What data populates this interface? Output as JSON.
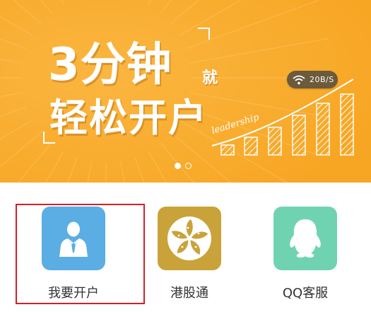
{
  "banner": {
    "slogan_line1": "3分钟",
    "slogan_jiu": "就",
    "slogan_line2": "轻松开户",
    "leadership": "leadership",
    "wifi_speed": "20B/S",
    "background_color": "#f9ab2e",
    "pager": {
      "total": 2,
      "active_index": 0
    }
  },
  "menu": {
    "items": [
      {
        "label": "我要开户",
        "icon": "business-person-icon",
        "color": "#5aaee3",
        "highlighted": true
      },
      {
        "label": "港股通",
        "icon": "hong-kong-flower-icon",
        "color": "#c9a239",
        "highlighted": false
      },
      {
        "label": "QQ客服",
        "icon": "qq-penguin-icon",
        "color": "#6fd3b2",
        "highlighted": false
      }
    ],
    "highlight_color": "#d32027"
  }
}
